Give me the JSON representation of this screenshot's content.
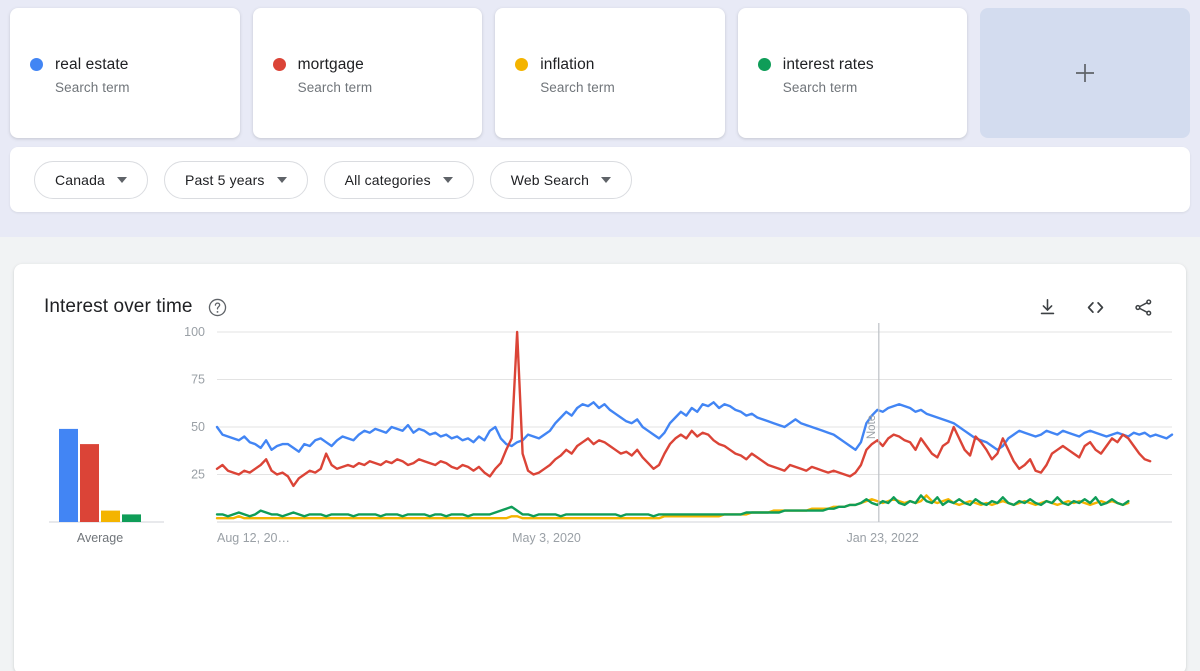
{
  "terms": [
    {
      "name": "real estate",
      "type": "Search term",
      "color": "#4285F4"
    },
    {
      "name": "mortgage",
      "type": "Search term",
      "color": "#DB4437"
    },
    {
      "name": "inflation",
      "type": "Search term",
      "color": "#F4B400"
    },
    {
      "name": "interest rates",
      "type": "Search term",
      "color": "#0F9D58"
    }
  ],
  "add_card": {
    "icon": "plus-icon",
    "label": "+"
  },
  "filters": [
    {
      "label": "Canada",
      "name": "region"
    },
    {
      "label": "Past 5 years",
      "name": "time-range"
    },
    {
      "label": "All categories",
      "name": "category"
    },
    {
      "label": "Web Search",
      "name": "search-type"
    }
  ],
  "chart_panel": {
    "title": "Interest over time",
    "help_icon": "help-circle-icon",
    "actions": [
      {
        "name": "download-csv-button",
        "icon": "download-icon"
      },
      {
        "name": "embed-button",
        "icon": "code-brackets-icon"
      },
      {
        "name": "share-button",
        "icon": "share-icon"
      }
    ]
  },
  "chart_data": {
    "type": "line",
    "title": "Interest over time",
    "xlabel": "",
    "ylabel": "",
    "ylim": [
      0,
      100
    ],
    "yticks": [
      0,
      25,
      50,
      75,
      100
    ],
    "ytick_labels": [
      "",
      "25",
      "50",
      "75",
      "100"
    ],
    "grid": true,
    "legend": "top-cards",
    "xtick_labels": [
      "Aug 12, 20…",
      "May 3, 2020",
      "Jan 23, 2022"
    ],
    "xtick_positions": [
      0,
      0.345,
      0.697
    ],
    "annotation": {
      "label": "Note",
      "position": 0.693
    },
    "average_panel": {
      "label": "Average",
      "values": [
        49,
        41,
        6,
        4
      ]
    },
    "series": [
      {
        "name": "real estate",
        "color": "#4285F4",
        "values": [
          50,
          46,
          45,
          44,
          43,
          45,
          42,
          41,
          39,
          43,
          38,
          40,
          41,
          41,
          39,
          37,
          41,
          40,
          43,
          44,
          42,
          40,
          43,
          45,
          44,
          43,
          46,
          48,
          47,
          49,
          48,
          47,
          50,
          49,
          48,
          51,
          47,
          49,
          48,
          46,
          47,
          45,
          46,
          44,
          45,
          43,
          44,
          42,
          45,
          43,
          48,
          50,
          44,
          41,
          40,
          42,
          43,
          46,
          45,
          44,
          46,
          48,
          52,
          55,
          58,
          56,
          60,
          62,
          61,
          63,
          60,
          62,
          59,
          57,
          55,
          53,
          52,
          54,
          50,
          48,
          46,
          44,
          47,
          52,
          55,
          58,
          56,
          60,
          58,
          62,
          61,
          63,
          60,
          62,
          61,
          59,
          58,
          56,
          57,
          55,
          54,
          53,
          52,
          51,
          50,
          52,
          54,
          52,
          51,
          50,
          49,
          48,
          47,
          46,
          44,
          42,
          40,
          38,
          42,
          52,
          56,
          59,
          58,
          60,
          61,
          62,
          61,
          60,
          58,
          59,
          57,
          56,
          55,
          54,
          53,
          52,
          50,
          48,
          46,
          44,
          43,
          42,
          40,
          38,
          40,
          44,
          46,
          48,
          47,
          46,
          45,
          46,
          48,
          47,
          46,
          48,
          47,
          46,
          45,
          47,
          48,
          47,
          46,
          45,
          46,
          47,
          46,
          45,
          47,
          46,
          47,
          45,
          46,
          45,
          44,
          46
        ]
      },
      {
        "name": "mortgage",
        "color": "#DB4437",
        "values": [
          28,
          30,
          27,
          26,
          25,
          27,
          26,
          28,
          30,
          33,
          27,
          25,
          26,
          24,
          19,
          23,
          25,
          27,
          26,
          28,
          36,
          30,
          28,
          29,
          30,
          29,
          31,
          30,
          32,
          31,
          30,
          32,
          31,
          33,
          32,
          30,
          31,
          33,
          32,
          31,
          30,
          32,
          31,
          29,
          28,
          30,
          29,
          27,
          29,
          26,
          24,
          28,
          31,
          38,
          44,
          100,
          36,
          27,
          25,
          26,
          28,
          30,
          33,
          35,
          38,
          36,
          40,
          42,
          44,
          41,
          43,
          42,
          40,
          38,
          36,
          37,
          35,
          38,
          34,
          31,
          28,
          30,
          36,
          41,
          44,
          46,
          44,
          48,
          45,
          47,
          46,
          43,
          41,
          40,
          38,
          36,
          35,
          33,
          36,
          34,
          32,
          30,
          29,
          28,
          27,
          30,
          29,
          28,
          27,
          29,
          28,
          27,
          26,
          27,
          26,
          25,
          24,
          26,
          30,
          38,
          41,
          43,
          40,
          44,
          46,
          45,
          43,
          42,
          38,
          44,
          40,
          36,
          34,
          40,
          42,
          50,
          44,
          38,
          35,
          45,
          42,
          38,
          33,
          36,
          44,
          38,
          32,
          28,
          30,
          33,
          27,
          26,
          30,
          36,
          38,
          40,
          38,
          36,
          34,
          40,
          42,
          38,
          36,
          40,
          44,
          42,
          46,
          44,
          40,
          36,
          33,
          32
        ]
      },
      {
        "name": "inflation",
        "color": "#F4B400",
        "values": [
          2,
          2,
          2,
          2,
          3,
          2,
          2,
          2,
          2,
          2,
          2,
          2,
          2,
          2,
          2,
          2,
          2,
          2,
          2,
          2,
          2,
          2,
          2,
          2,
          2,
          2,
          2,
          2,
          2,
          2,
          2,
          2,
          2,
          2,
          2,
          2,
          2,
          2,
          2,
          2,
          2,
          2,
          2,
          2,
          2,
          2,
          2,
          2,
          2,
          2,
          2,
          2,
          2,
          2,
          3,
          3,
          2,
          2,
          2,
          2,
          2,
          2,
          2,
          2,
          2,
          2,
          2,
          2,
          2,
          2,
          2,
          2,
          2,
          2,
          2,
          2,
          2,
          2,
          2,
          2,
          2,
          2,
          3,
          3,
          3,
          3,
          3,
          3,
          3,
          3,
          3,
          3,
          3,
          4,
          4,
          4,
          4,
          4,
          5,
          5,
          5,
          5,
          6,
          6,
          6,
          6,
          6,
          6,
          6,
          7,
          7,
          7,
          7,
          8,
          8,
          8,
          9,
          9,
          10,
          11,
          12,
          11,
          10,
          11,
          12,
          11,
          10,
          11,
          10,
          11,
          14,
          11,
          10,
          11,
          12,
          10,
          9,
          10,
          11,
          10,
          9,
          10,
          9,
          10,
          11,
          10,
          9,
          10,
          11,
          10,
          9,
          10,
          11,
          10,
          9,
          10,
          11,
          10,
          11,
          10,
          9,
          10,
          11,
          10,
          11,
          10,
          9,
          10
        ]
      },
      {
        "name": "interest rates",
        "color": "#0F9D58",
        "values": [
          4,
          4,
          3,
          4,
          5,
          4,
          3,
          4,
          6,
          5,
          4,
          4,
          3,
          4,
          5,
          4,
          3,
          4,
          4,
          4,
          3,
          4,
          4,
          4,
          4,
          3,
          4,
          4,
          4,
          4,
          3,
          4,
          4,
          4,
          3,
          4,
          4,
          4,
          4,
          3,
          4,
          4,
          3,
          4,
          4,
          4,
          3,
          4,
          4,
          4,
          4,
          5,
          6,
          7,
          8,
          6,
          4,
          4,
          3,
          4,
          4,
          4,
          4,
          3,
          4,
          4,
          4,
          4,
          4,
          4,
          4,
          4,
          4,
          4,
          3,
          4,
          4,
          4,
          4,
          4,
          3,
          4,
          4,
          4,
          4,
          4,
          4,
          4,
          4,
          4,
          4,
          4,
          4,
          4,
          4,
          4,
          4,
          5,
          5,
          5,
          5,
          5,
          5,
          5,
          6,
          6,
          6,
          6,
          6,
          6,
          6,
          6,
          7,
          7,
          8,
          8,
          9,
          9,
          10,
          12,
          10,
          9,
          11,
          10,
          13,
          10,
          9,
          11,
          10,
          14,
          11,
          10,
          13,
          9,
          11,
          10,
          12,
          10,
          9,
          12,
          10,
          9,
          11,
          10,
          13,
          10,
          9,
          11,
          10,
          12,
          10,
          9,
          11,
          10,
          13,
          10,
          9,
          11,
          10,
          12,
          10,
          13,
          9,
          10,
          12,
          10,
          9,
          11
        ]
      }
    ]
  }
}
